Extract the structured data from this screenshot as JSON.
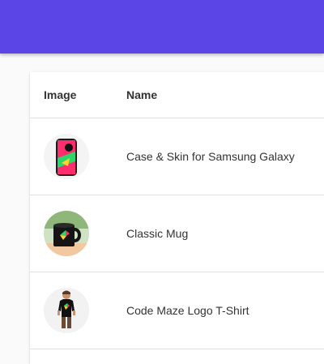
{
  "table": {
    "headers": {
      "image": "Image",
      "name": "Name"
    },
    "rows": [
      {
        "image_icon": "phone-case-icon",
        "name": "Case & Skin for Samsung Galaxy"
      },
      {
        "image_icon": "mug-icon",
        "name": "Classic Mug"
      },
      {
        "image_icon": "tshirt-icon",
        "name": "Code Maze Logo T-Shirt"
      }
    ]
  },
  "colors": {
    "topbar": "#5c45e6",
    "background": "#fafafa",
    "card": "#ffffff",
    "divider": "#e0e0e0"
  }
}
